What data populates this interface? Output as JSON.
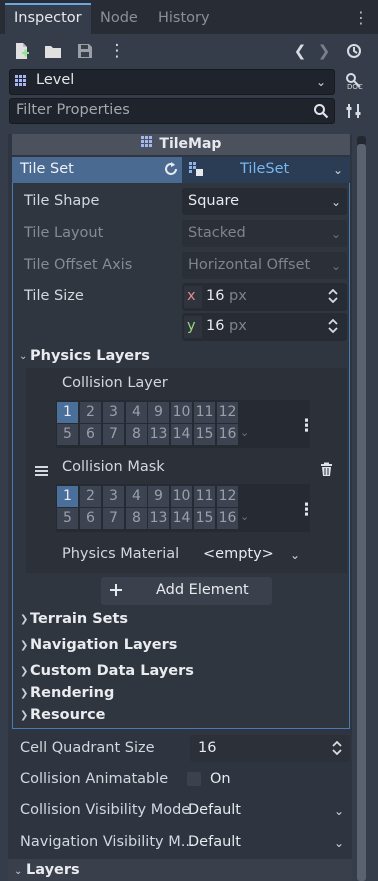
{
  "tabs": [
    "Inspector",
    "Node",
    "History"
  ],
  "toolbar": {
    "history_back": "❮",
    "history_fwd": "❯"
  },
  "object_selector": {
    "value": "Level"
  },
  "filter": {
    "placeholder": "Filter Properties"
  },
  "node_header": "TileMap",
  "tile_set": {
    "label": "Tile Set",
    "resource": "TileSet"
  },
  "props": [
    {
      "label": "Tile Shape",
      "value": "Square"
    },
    {
      "label": "Tile Layout",
      "value": "Stacked"
    },
    {
      "label": "Tile Offset Axis",
      "value": "Horizontal Offset"
    },
    {
      "label": "Tile Size"
    }
  ],
  "tile_size": {
    "x_label": "x",
    "x": "16",
    "y_label": "y",
    "y": "16",
    "unit": "px"
  },
  "physics_layers": {
    "title": "Physics Layers",
    "collision_layer": "Collision Layer",
    "collision_mask": "Collision Mask",
    "bits_row1": [
      "1",
      "2",
      "3",
      "4",
      "9",
      "10",
      "11",
      "12"
    ],
    "bits_row2": [
      "5",
      "6",
      "7",
      "8",
      "13",
      "14",
      "15",
      "16"
    ],
    "physics_material_label": "Physics Material",
    "physics_material_value": "<empty>",
    "add_element": "Add Element"
  },
  "sections": [
    "Terrain Sets",
    "Navigation Layers",
    "Custom Data Layers",
    "Rendering",
    "Resource"
  ],
  "bottom_props": [
    {
      "label": "Cell Quadrant Size",
      "value": "16"
    },
    {
      "label": "Collision Animatable",
      "value": "On"
    },
    {
      "label": "Collision Visibility Mode",
      "value": "Default"
    },
    {
      "label": "Navigation Visibility M...",
      "value": "Default"
    }
  ],
  "layers_title": "Layers",
  "colors": {
    "accent": "#6aa7e3",
    "selected_bit": "#4a6f9b",
    "panel": "#363d4a"
  }
}
